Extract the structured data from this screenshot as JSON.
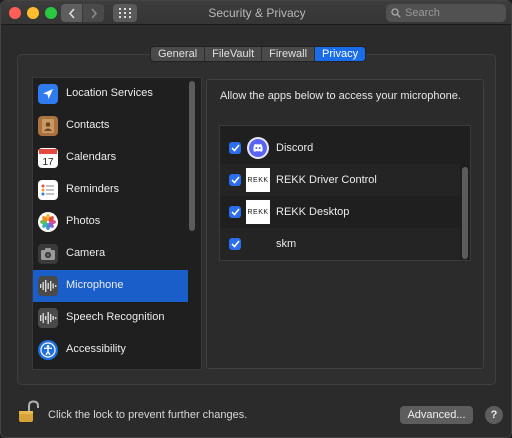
{
  "window": {
    "title": "Security & Privacy"
  },
  "search": {
    "placeholder": "Search"
  },
  "tabs": [
    {
      "label": "General"
    },
    {
      "label": "FileVault"
    },
    {
      "label": "Firewall"
    },
    {
      "label": "Privacy",
      "active": true
    }
  ],
  "sidebar": {
    "items": [
      {
        "label": "Location Services",
        "icon": "location-arrow-icon"
      },
      {
        "label": "Contacts",
        "icon": "contacts-book-icon"
      },
      {
        "label": "Calendars",
        "icon": "calendar-icon",
        "icon_text": "17"
      },
      {
        "label": "Reminders",
        "icon": "reminders-list-icon"
      },
      {
        "label": "Photos",
        "icon": "photos-flower-icon"
      },
      {
        "label": "Camera",
        "icon": "camera-icon"
      },
      {
        "label": "Microphone",
        "icon": "microphone-waveform-icon",
        "selected": true
      },
      {
        "label": "Speech Recognition",
        "icon": "speech-waveform-icon"
      },
      {
        "label": "Accessibility",
        "icon": "accessibility-person-icon"
      }
    ]
  },
  "main": {
    "heading": "Allow the apps below to access your microphone.",
    "apps": [
      {
        "name": "Discord",
        "checked": true,
        "icon": "discord-icon"
      },
      {
        "name": "REKK Driver Control",
        "checked": true,
        "icon": "rekk-logo-icon",
        "icon_text": "REKK"
      },
      {
        "name": "REKK Desktop",
        "checked": true,
        "icon": "rekk-logo-icon",
        "icon_text": "REKK"
      },
      {
        "name": "skm",
        "checked": true,
        "icon": ""
      }
    ]
  },
  "footer": {
    "lock_text": "Click the lock to prevent further changes.",
    "advanced_label": "Advanced...",
    "help_label": "?"
  },
  "colors": {
    "accent": "#1a6ce8",
    "selection": "#1a5fc9",
    "checkbox": "#2a6ef0"
  }
}
